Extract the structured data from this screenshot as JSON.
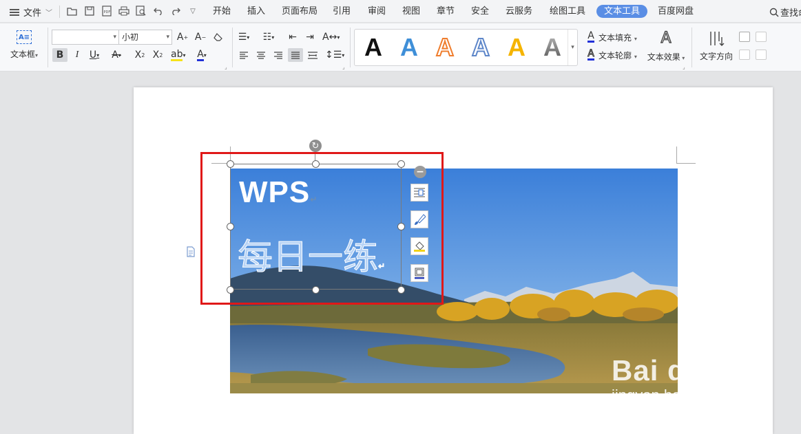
{
  "menubar": {
    "file_label": "文件",
    "tabs": [
      {
        "label": "开始"
      },
      {
        "label": "插入"
      },
      {
        "label": "页面布局"
      },
      {
        "label": "引用"
      },
      {
        "label": "审阅"
      },
      {
        "label": "视图"
      },
      {
        "label": "章节"
      },
      {
        "label": "安全"
      },
      {
        "label": "云服务"
      },
      {
        "label": "绘图工具"
      },
      {
        "label": "文本工具",
        "active": true
      },
      {
        "label": "百度网盘"
      }
    ],
    "search_label": "查找命"
  },
  "ribbon": {
    "textbox_label": "文本框",
    "font_name": "",
    "font_size": "小初",
    "style_colors": [
      "#111111",
      "#3f8fd8",
      "#ef7d2d",
      "#5d86c9",
      "#f5b400",
      "#8a8a8a"
    ],
    "text_fill_label": "文本填充",
    "text_outline_label": "文本轮廓",
    "text_effect_label": "文本效果",
    "text_direction_label": "文字方向"
  },
  "document": {
    "textbox_line1": "WPS",
    "textbox_line2": "每日一练",
    "side_tools": [
      "layout-options-icon",
      "brush-icon",
      "fill-icon",
      "border-icon"
    ]
  },
  "watermark": {
    "logo": "Bai du 经验",
    "url": "jingyan.baidu.com"
  }
}
